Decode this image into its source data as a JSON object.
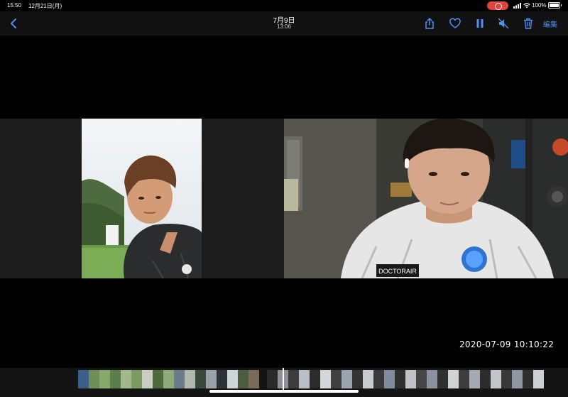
{
  "status_bar": {
    "time": "15:50",
    "date": "12月21日(月)",
    "battery": "100%"
  },
  "nav": {
    "date": "7月9日",
    "time": "13:06",
    "edit_label": "編集",
    "icons": [
      "chevron-left-icon",
      "share-icon",
      "heart-icon",
      "pause-icon",
      "mute-icon",
      "trash-icon"
    ]
  },
  "video": {
    "timestamp": "2020-07-09  10:10:22"
  },
  "colors": {
    "accent": "#4d8ff5",
    "record": "#e0453a"
  }
}
